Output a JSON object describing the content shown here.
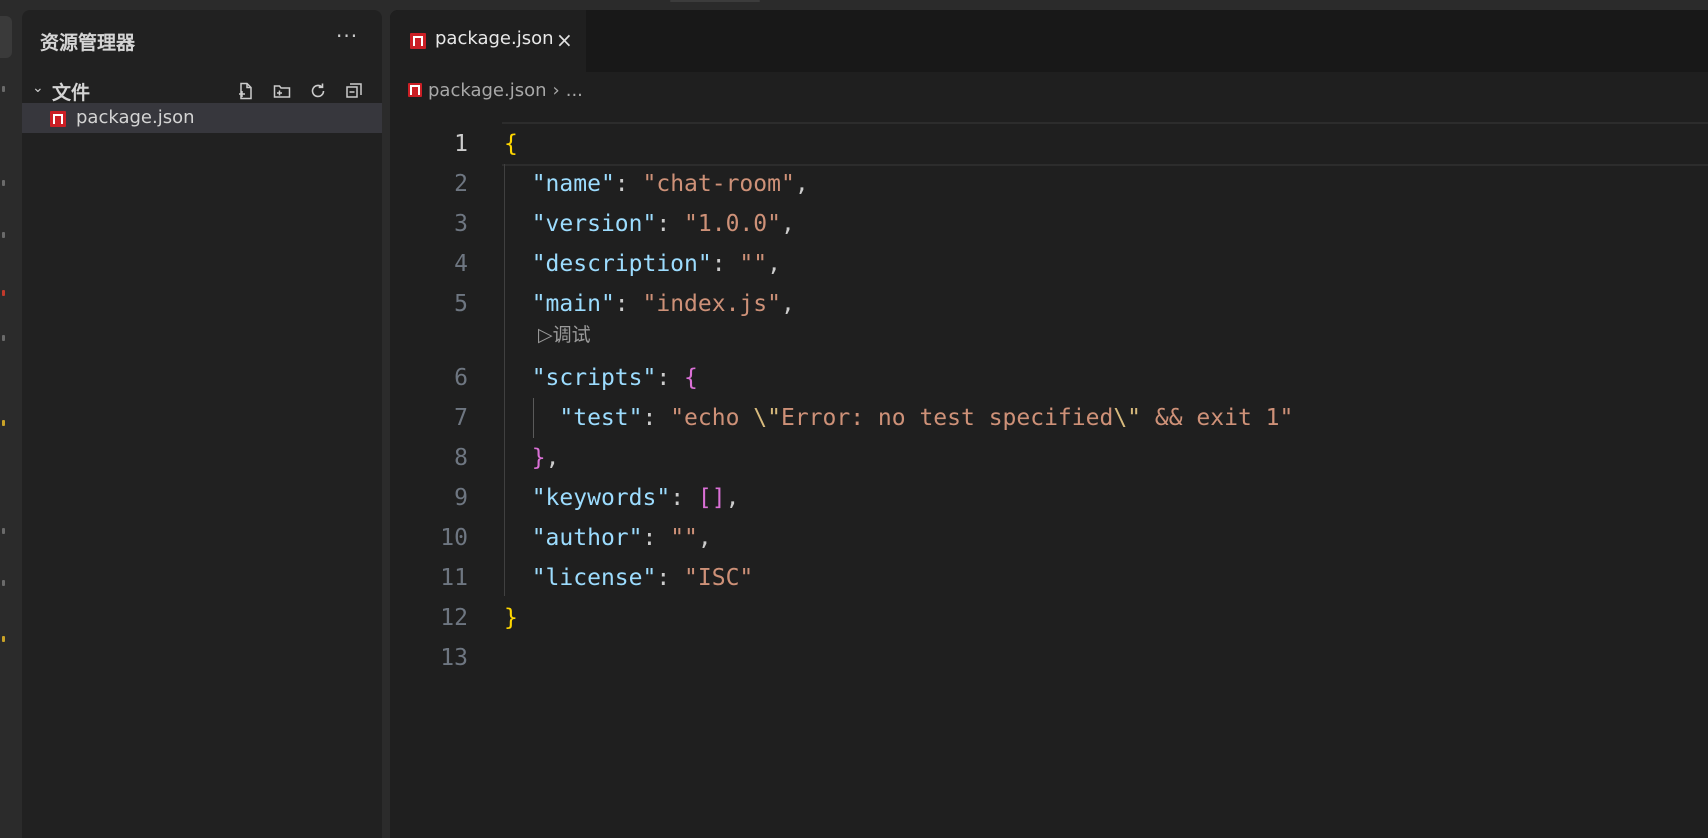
{
  "sidebar": {
    "title": "资源管理器",
    "more": "···",
    "section": {
      "title": "文件",
      "actions": [
        "new-file-icon",
        "new-folder-icon",
        "refresh-icon",
        "collapse-all-icon"
      ]
    },
    "files": [
      {
        "name": "package.json",
        "icon": "npm-icon"
      }
    ]
  },
  "editor": {
    "tab": {
      "label": "package.json",
      "close": "×"
    },
    "breadcrumb": {
      "file": "package.json",
      "separator": "›",
      "more": "..."
    },
    "codelens": "▷调试",
    "line_numbers": [
      "1",
      "2",
      "3",
      "4",
      "5",
      "6",
      "7",
      "8",
      "9",
      "10",
      "11",
      "12",
      "13"
    ],
    "lines": [
      {
        "t": [
          [
            "{",
            "c-brace"
          ]
        ]
      },
      {
        "t": [
          [
            "  ",
            ""
          ],
          [
            "\"name\"",
            "c-key"
          ],
          [
            ": ",
            "c-punc"
          ],
          [
            "\"chat-room\"",
            "c-str"
          ],
          [
            ",",
            "c-punc"
          ]
        ]
      },
      {
        "t": [
          [
            "  ",
            ""
          ],
          [
            "\"version\"",
            "c-key"
          ],
          [
            ": ",
            "c-punc"
          ],
          [
            "\"1.0.0\"",
            "c-str"
          ],
          [
            ",",
            "c-punc"
          ]
        ]
      },
      {
        "t": [
          [
            "  ",
            ""
          ],
          [
            "\"description\"",
            "c-key"
          ],
          [
            ": ",
            "c-punc"
          ],
          [
            "\"\"",
            "c-str"
          ],
          [
            ",",
            "c-punc"
          ]
        ]
      },
      {
        "t": [
          [
            "  ",
            ""
          ],
          [
            "\"main\"",
            "c-key"
          ],
          [
            ": ",
            "c-punc"
          ],
          [
            "\"index.js\"",
            "c-str"
          ],
          [
            ",",
            "c-punc"
          ]
        ]
      },
      {
        "t": [
          [
            "  ",
            ""
          ],
          [
            "\"scripts\"",
            "c-key"
          ],
          [
            ": ",
            "c-punc"
          ],
          [
            "{",
            "c-brace2"
          ]
        ]
      },
      {
        "t": [
          [
            "    ",
            ""
          ],
          [
            "\"test\"",
            "c-key"
          ],
          [
            ": ",
            "c-punc"
          ],
          [
            "\"echo ",
            "c-str"
          ],
          [
            "\\\"",
            "c-esc"
          ],
          [
            "Error: no test specified",
            "c-str"
          ],
          [
            "\\\"",
            "c-esc"
          ],
          [
            " && exit 1\"",
            "c-str"
          ]
        ]
      },
      {
        "t": [
          [
            "  ",
            ""
          ],
          [
            "}",
            "c-brace2"
          ],
          [
            ",",
            "c-punc"
          ]
        ]
      },
      {
        "t": [
          [
            "  ",
            ""
          ],
          [
            "\"keywords\"",
            "c-key"
          ],
          [
            ": ",
            "c-punc"
          ],
          [
            "[]",
            "c-brace2"
          ],
          [
            ",",
            "c-punc"
          ]
        ]
      },
      {
        "t": [
          [
            "  ",
            ""
          ],
          [
            "\"author\"",
            "c-key"
          ],
          [
            ": ",
            "c-punc"
          ],
          [
            "\"\"",
            "c-str"
          ],
          [
            ",",
            "c-punc"
          ]
        ]
      },
      {
        "t": [
          [
            "  ",
            ""
          ],
          [
            "\"license\"",
            "c-key"
          ],
          [
            ": ",
            "c-punc"
          ],
          [
            "\"ISC\"",
            "c-str"
          ]
        ]
      },
      {
        "t": [
          [
            "}",
            "c-brace"
          ]
        ]
      },
      {
        "t": []
      }
    ]
  },
  "colors": {
    "accent_npm": "#cb1f25",
    "editor_bg": "#1f1f1f",
    "sidebar_bg": "#212121",
    "key": "#9cdcfe",
    "string": "#ce9178",
    "brace": "#ffd700",
    "brace2": "#da70d6"
  }
}
